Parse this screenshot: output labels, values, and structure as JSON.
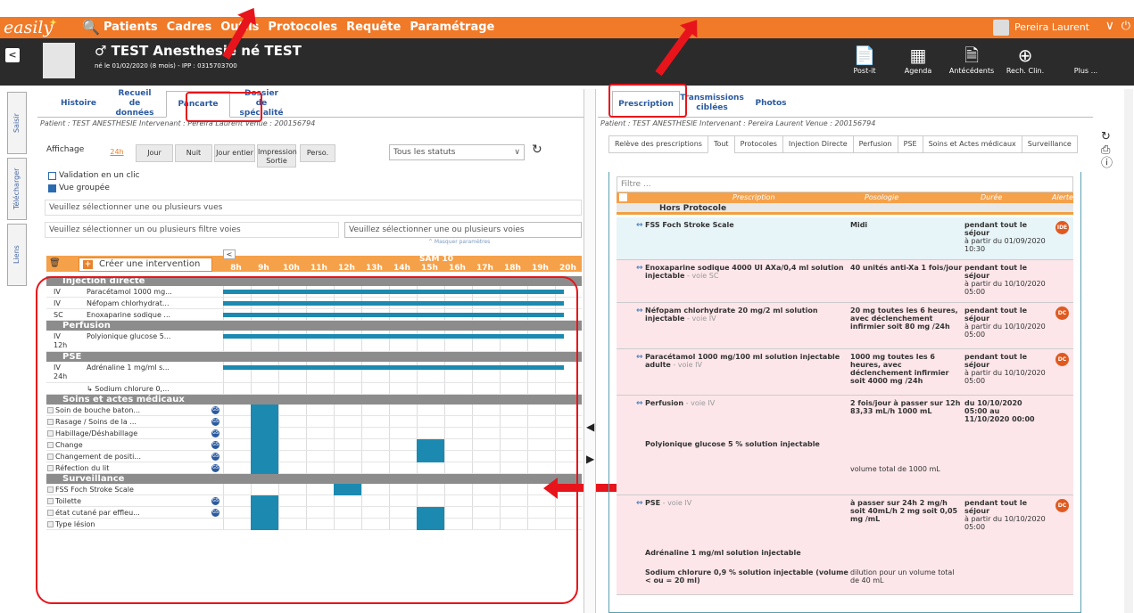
{
  "header": {
    "logo": "easily",
    "menu": [
      "Patients",
      "Cadres",
      "Outils",
      "Protocoles",
      "Requête",
      "Paramétrage"
    ],
    "user": "Pereira Laurent"
  },
  "patient": {
    "name": "♂ TEST Anesthesie né TEST",
    "info": "né le 01/02/2020 (8 mois) - IPP : 0315703700"
  },
  "tools": [
    {
      "icon": "📄",
      "label": "Post-it"
    },
    {
      "icon": "▦",
      "label": "Agenda"
    },
    {
      "icon": "🗎",
      "label": "Antécédents"
    },
    {
      "icon": "⊕",
      "label": "Rech. Clin."
    },
    {
      "icon": "",
      "label": "Plus ..."
    }
  ],
  "sidetabs": [
    "Saisir",
    "Télécharger",
    "Liens"
  ],
  "left": {
    "tabs": [
      "Histoire",
      "Recueil de données",
      "Pancarte",
      "Dossier de spécialité"
    ],
    "info": "Patient : TEST ANESTHESIE   Intervenant : Pereira Laurent   Venue : 200156794",
    "affichage": "Affichage",
    "buttons": [
      "24h",
      "Jour",
      "Nuit",
      "Jour entier",
      "Impression Sortie",
      "Perso."
    ],
    "status": "Tous les statuts",
    "validation": "Validation en un clic",
    "vue": "Vue groupée",
    "vues_ph": "Veuillez sélectionner une ou plusieurs vues",
    "filtre_ph1": "Veuillez sélectionner un ou plusieurs filtre voies",
    "filtre_ph2": "Veuillez sélectionner une ou plusieurs voies",
    "masquer": "^ Masquer paramètres",
    "creer": "Créer une intervention",
    "day": "SAM 10",
    "hours": [
      "8h",
      "9h",
      "10h",
      "11h",
      "12h",
      "13h",
      "14h",
      "15h",
      "16h",
      "17h",
      "18h",
      "19h",
      "20h"
    ],
    "sections": [
      {
        "title": "Injection directe",
        "rows": [
          {
            "route": "IV",
            "name": "Paracétamol 1000 mg..."
          },
          {
            "route": "IV",
            "name": "Néfopam chlorhydrat..."
          },
          {
            "route": "SC",
            "name": "Enoxaparine sodique ..."
          }
        ]
      },
      {
        "title": "Perfusion",
        "rows": [
          {
            "route": "IV",
            "name": "Polyionique glucose 5...",
            "sub": "12h"
          }
        ]
      },
      {
        "title": "PSE",
        "rows": [
          {
            "route": "IV",
            "name": "Adrénaline 1 mg/ml s...",
            "sub": "24h"
          },
          {
            "route": "",
            "name": "↳ Sodium chlorure 0,..."
          }
        ]
      },
      {
        "title": "Soins et actes médicaux",
        "rows": [
          {
            "name": "Soin de bouche baton..."
          },
          {
            "name": "Rasage / Soins de la ..."
          },
          {
            "name": "Habillage/Déshabillage"
          },
          {
            "name": "Change"
          },
          {
            "name": "Changement de positi..."
          },
          {
            "name": "Réfection du lit"
          }
        ]
      },
      {
        "title": "Surveillance",
        "rows": [
          {
            "name": "FSS Foch Stroke Scale"
          },
          {
            "name": "Toilette"
          },
          {
            "name": "état cutané par effleu..."
          },
          {
            "name": "Type lésion"
          }
        ]
      }
    ]
  },
  "right": {
    "tabs": [
      "Prescription",
      "Transmissions ciblées",
      "Photos"
    ],
    "info": "Patient : TEST ANESTHESIE   Intervenant : Pereira Laurent   Venue : 200156794",
    "subtabs": [
      "Relève des prescriptions",
      "Tout",
      "Protocoles",
      "Injection Directe",
      "Perfusion",
      "PSE",
      "Soins et Actes médicaux",
      "Surveillance"
    ],
    "filtre": "Filtre ...",
    "cols": [
      "Prescription",
      "Posologie",
      "Durée",
      "Alertes"
    ],
    "group": "Hors Protocole",
    "rows": [
      {
        "name": "FSS Foch Stroke Scale",
        "voie": "",
        "poso": "Midi",
        "duree": "pendant tout le séjour",
        "from": "à partir du 01/09/2020 10:30",
        "badge": "IDE",
        "color": "blue",
        "h": 48
      },
      {
        "name": "Enoxaparine sodique 4000 UI AXa/0,4 ml solution injectable",
        "voie": " - voie SC",
        "poso": "40 unités anti-Xa 1 fois/jour",
        "duree": "pendant tout le séjour",
        "from": "à partir du 10/10/2020 05:00",
        "badge": "",
        "color": "pink",
        "h": 48
      },
      {
        "name": "Néfopam chlorhydrate 20 mg/2 ml solution injectable",
        "voie": " - voie IV",
        "poso": "20 mg toutes les 6 heures, avec déclenchement infirmier soit 80 mg /24h",
        "duree": "pendant tout le séjour",
        "from": "à partir du 10/10/2020 05:00",
        "badge": "DC",
        "color": "pink",
        "h": 52
      },
      {
        "name": "Paracétamol 1000 mg/100 ml solution injectable adulte",
        "voie": " - voie IV",
        "poso": "1000 mg toutes les 6 heures, avec déclenchement infirmier soit 4000 mg /24h",
        "duree": "pendant tout le séjour",
        "from": "à partir du 10/10/2020 05:00",
        "badge": "DC",
        "color": "pink",
        "h": 52
      },
      {
        "name": "Perfusion",
        "voie": " - voie IV",
        "sub": "Polyionique glucose 5 % solution injectable",
        "poso": "2 fois/jour à passer sur 12h 83,33 mL/h 1000 mL",
        "poso2": "volume total de 1000 mL",
        "duree": "du 10/10/2020 05:00 au 11/10/2020 00:00",
        "from": "",
        "badge": "",
        "color": "pink",
        "h": 112
      },
      {
        "name": "PSE",
        "voie": " - voie IV",
        "sub": "Adrénaline 1 mg/ml solution injectable",
        "sub2": "Sodium chlorure 0,9 % solution injectable (volume < ou = 20 ml)",
        "poso": "à passer sur 24h  2 mg/h soit 40mL/h 2 mg soit 0,05 mg /mL",
        "poso2": "dilution pour un volume total de 40 mL",
        "duree": "pendant tout le séjour",
        "from": "à partir du 10/10/2020 05:00",
        "badge": "DC",
        "color": "pink",
        "h": 112
      }
    ]
  }
}
